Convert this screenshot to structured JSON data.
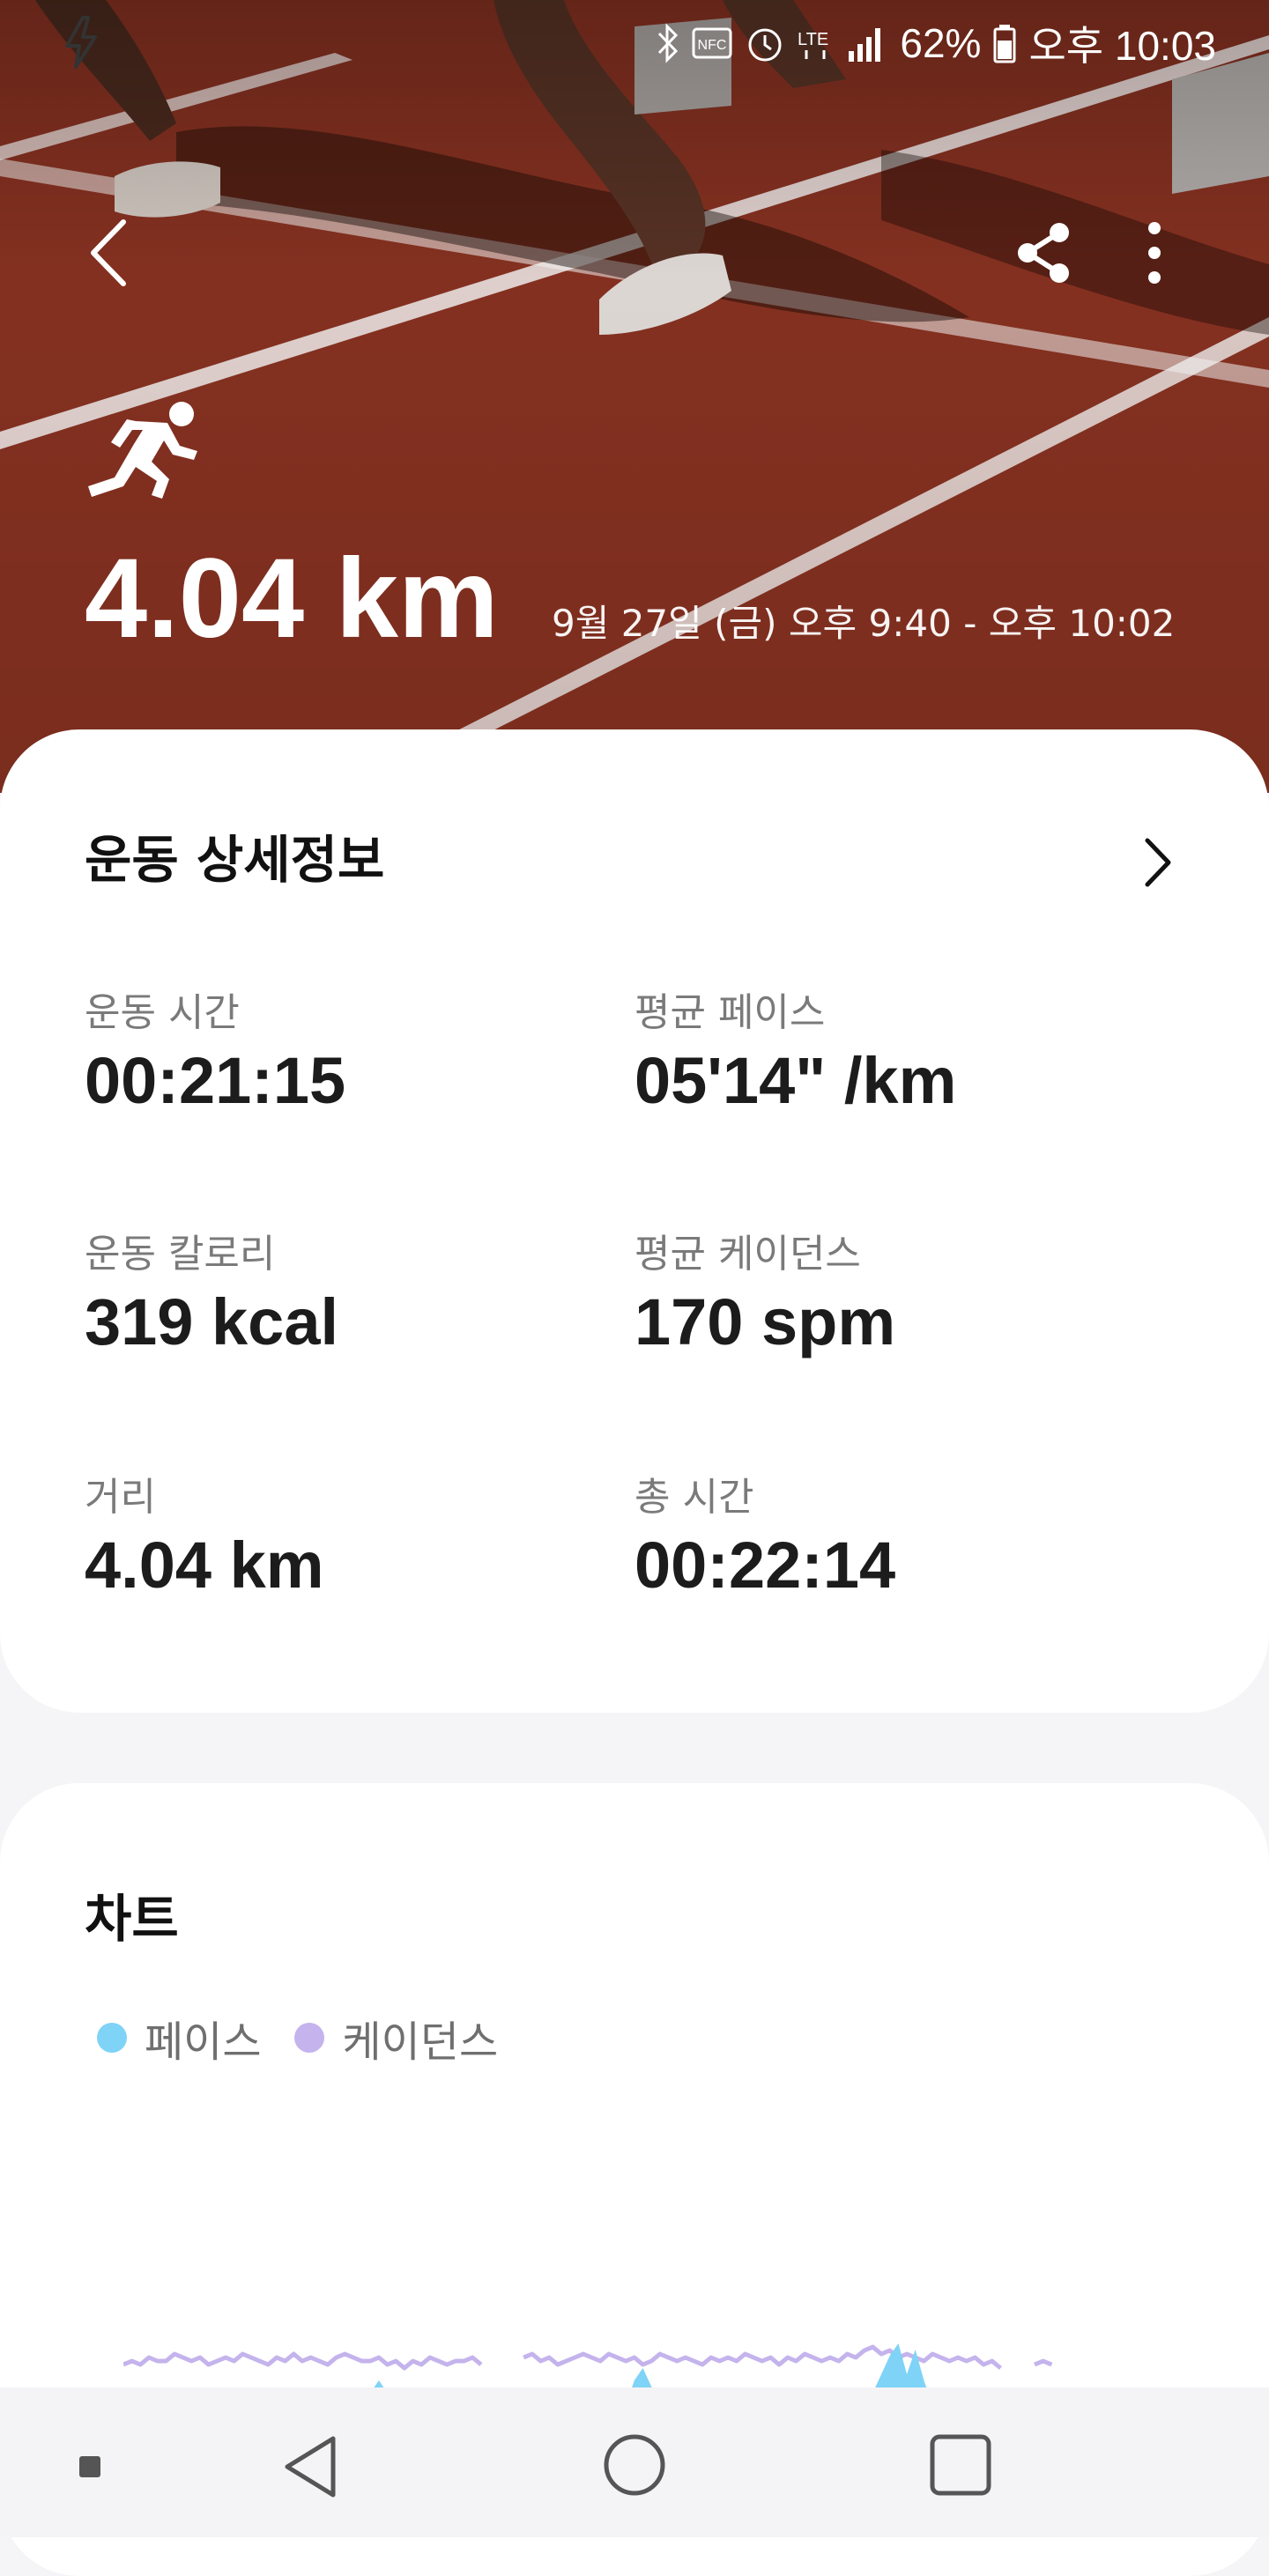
{
  "status_bar": {
    "battery": "62%",
    "time": "오후 10:03",
    "icons": [
      "power-saving-icon",
      "bluetooth-icon",
      "nfc-icon",
      "alarm-icon",
      "lte-icon",
      "signal-icon",
      "battery-icon"
    ]
  },
  "header": {
    "back_icon": "back-arrow-icon",
    "share_icon": "share-icon",
    "more_icon": "more-vertical-icon",
    "activity_icon": "running-icon"
  },
  "workout": {
    "distance": "4.04 km",
    "date_range": "9월 27일 (금) 오후 9:40 - 오후 10:02"
  },
  "details": {
    "title": "운동 상세정보",
    "stats": [
      {
        "label": "운동 시간",
        "value": "00:21:15"
      },
      {
        "label": "평균 페이스",
        "value": "05'14\" /km"
      },
      {
        "label": "운동 칼로리",
        "value": "319 kcal"
      },
      {
        "label": "평균 케이던스",
        "value": "170 spm"
      },
      {
        "label": "거리",
        "value": "4.04 km"
      },
      {
        "label": "총 시간",
        "value": "00:22:14"
      }
    ]
  },
  "chart": {
    "title": "차트",
    "legend": [
      {
        "label": "페이스",
        "color": "#7fd3f7"
      },
      {
        "label": "케이던스",
        "color": "#c4b3ec"
      }
    ]
  },
  "chart_data": {
    "type": "line",
    "title": "차트",
    "series": [
      {
        "name": "페이스",
        "color": "#7fd3f7",
        "values": [
          0,
          0,
          0,
          0,
          0,
          0,
          0,
          0,
          0,
          0,
          0,
          0,
          0,
          0,
          0,
          0,
          0,
          0,
          0,
          0,
          0,
          0,
          0,
          0,
          0,
          0,
          0,
          0,
          0,
          2,
          4,
          2,
          0,
          0,
          0,
          0,
          0,
          0,
          0,
          0,
          0,
          0,
          0,
          0,
          0,
          0,
          0,
          0,
          0,
          0,
          0,
          0,
          0,
          0,
          0,
          0,
          0,
          0,
          0,
          0,
          4,
          6,
          3,
          0,
          0,
          0,
          0,
          0,
          0,
          0,
          0,
          0,
          0,
          0,
          0,
          0,
          0,
          0,
          0,
          0,
          0,
          0,
          0,
          0,
          0,
          0,
          0,
          0,
          2,
          5,
          8,
          10,
          5,
          9,
          4,
          0,
          0,
          0,
          0,
          0,
          0,
          0,
          0,
          0,
          0,
          0,
          0,
          0,
          0,
          0,
          0,
          0,
          0,
          0,
          0,
          0,
          0,
          0,
          0,
          0
        ]
      },
      {
        "name": "케이던스",
        "color": "#c4b3ec",
        "values": [
          3,
          4,
          3,
          5,
          4,
          4,
          6,
          5,
          4,
          5,
          3,
          4,
          5,
          4,
          6,
          5,
          4,
          3,
          5,
          4,
          6,
          4,
          5,
          4,
          3,
          5,
          6,
          5,
          4,
          4,
          5,
          3,
          4,
          2,
          4,
          3,
          5,
          4,
          3,
          4,
          4,
          5,
          3,
          0,
          0,
          0,
          0,
          5,
          6,
          4,
          5,
          3,
          4,
          5,
          6,
          5,
          4,
          6,
          5,
          4,
          5,
          3,
          4,
          6,
          5,
          4,
          5,
          4,
          3,
          5,
          4,
          5,
          4,
          6,
          5,
          4,
          5,
          3,
          5,
          4,
          6,
          5,
          4,
          5,
          4,
          6,
          5,
          7,
          8,
          6,
          7,
          5,
          6,
          5,
          4,
          6,
          5,
          4,
          5,
          4,
          5,
          3,
          4,
          2,
          0,
          0,
          0,
          3,
          4,
          3,
          0,
          0,
          0,
          0,
          0,
          0,
          0,
          0,
          0,
          0
        ]
      }
    ]
  },
  "nav_bar": {
    "items": [
      "dot-icon",
      "nav-back-icon",
      "home-icon",
      "recents-icon"
    ]
  }
}
